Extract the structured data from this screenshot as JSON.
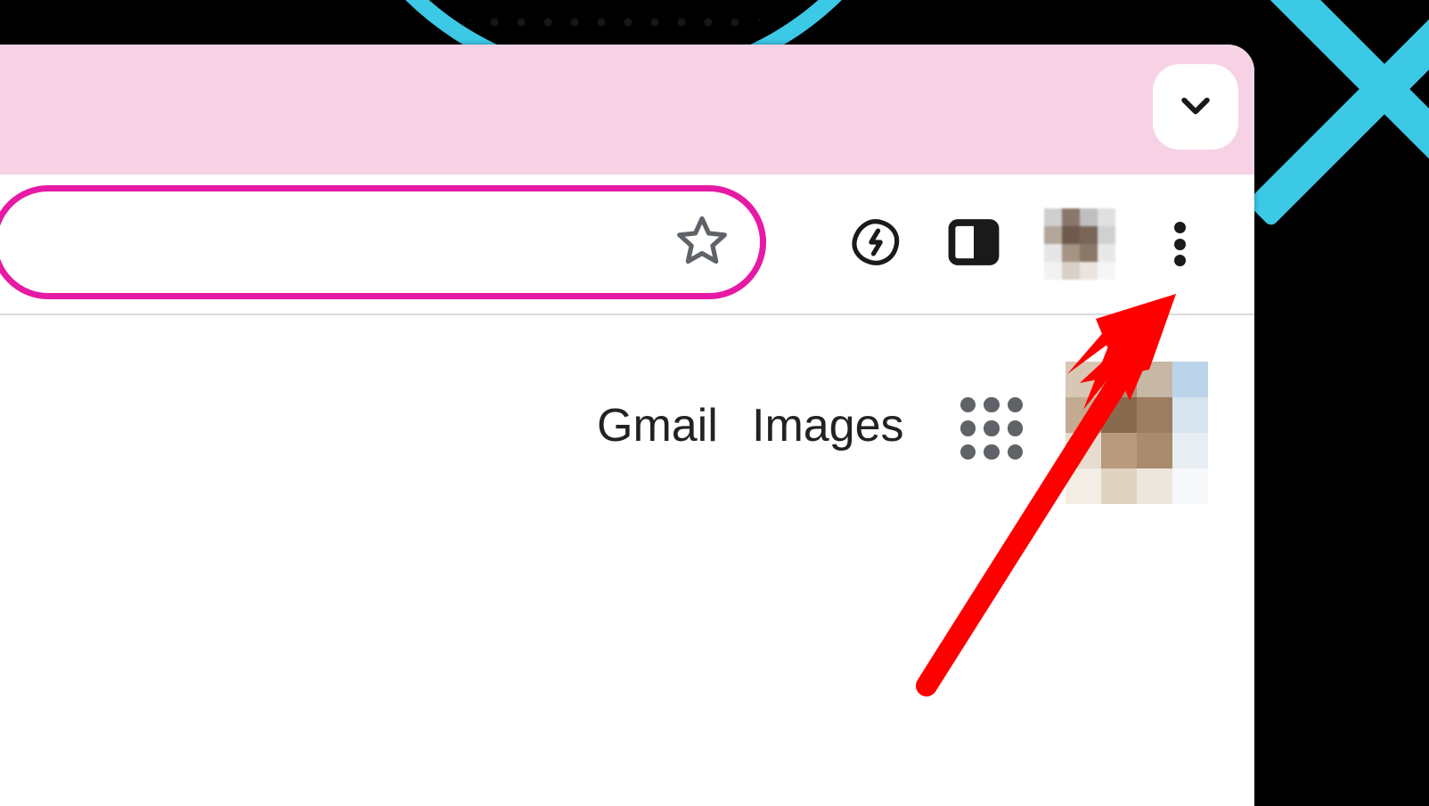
{
  "browser": {
    "theme_tabstrip_color": "#f6d2e4",
    "theme_accent_color": "#e61aa4"
  },
  "toolbar": {
    "dropdown_label": "Search tabs",
    "bookmark_label": "Bookmark",
    "extension_label": "Extension",
    "sidepanel_label": "Side panel",
    "profile_label": "Profile",
    "menu_label": "Customize and control Google Chrome"
  },
  "page": {
    "gmail_label": "Gmail",
    "images_label": "Images",
    "apps_label": "Google apps",
    "account_label": "Google Account"
  },
  "annotation": {
    "arrow_color": "#ff0000",
    "target": "chrome-menu"
  }
}
